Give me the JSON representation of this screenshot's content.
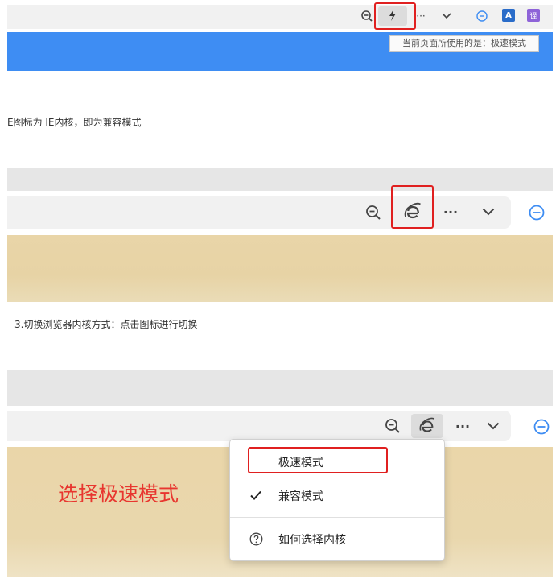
{
  "shot1": {
    "tooltip": "当前页面所使用的是：极速模式",
    "icons": [
      "zoom-out-icon",
      "lightning-icon",
      "more-icon",
      "chevron-down-icon",
      "minus-circle-icon",
      "a-extension-icon",
      "translate-icon"
    ],
    "ext_a": "A",
    "ext_translate": "译",
    "colors": {
      "accent": "#3e8df3",
      "highlight": "#e02020"
    }
  },
  "caption1": "E图标为 IE内核，即为兼容模式",
  "caption2": "3.切换浏览器内核方式：点击图标进行切换",
  "menu": {
    "items": [
      {
        "label": "极速模式",
        "checked": false
      },
      {
        "label": "兼容模式",
        "checked": true
      },
      {
        "label": "如何选择内核",
        "icon": "question-circle-icon"
      }
    ]
  },
  "annotation": "选择极速模式"
}
